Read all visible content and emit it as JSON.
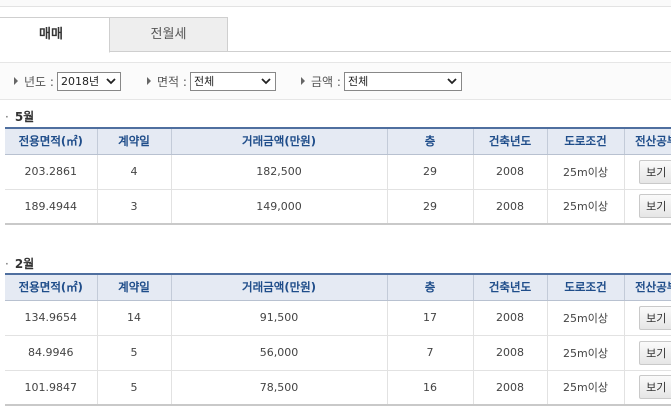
{
  "tabs": [
    {
      "label": "매매",
      "active": true
    },
    {
      "label": "전월세",
      "active": false
    }
  ],
  "filters": {
    "year": {
      "label": "년도 :",
      "value": "2018년"
    },
    "area": {
      "label": "면적 :",
      "value": "전체"
    },
    "price": {
      "label": "금액 :",
      "value": "전체"
    }
  },
  "columns": [
    "전용면적(㎡)",
    "계약일",
    "거래금액(만원)",
    "층",
    "건축년도",
    "도로조건",
    "전산공부"
  ],
  "sections": [
    {
      "month": "5월",
      "rows": [
        {
          "area": "203.2861",
          "day": "4",
          "price": "182,500",
          "floor": "29",
          "built": "2008",
          "road": "25m이상",
          "action": "보기"
        },
        {
          "area": "189.4944",
          "day": "3",
          "price": "149,000",
          "floor": "29",
          "built": "2008",
          "road": "25m이상",
          "action": "보기"
        }
      ]
    },
    {
      "month": "2월",
      "rows": [
        {
          "area": "134.9654",
          "day": "14",
          "price": "91,500",
          "floor": "17",
          "built": "2008",
          "road": "25m이상",
          "action": "보기"
        },
        {
          "area": "84.9946",
          "day": "5",
          "price": "56,000",
          "floor": "7",
          "built": "2008",
          "road": "25m이상",
          "action": "보기"
        },
        {
          "area": "101.9847",
          "day": "5",
          "price": "78,500",
          "floor": "16",
          "built": "2008",
          "road": "25m이상",
          "action": "보기"
        }
      ]
    }
  ],
  "colors": {
    "header_text": "#1f4d8a",
    "header_bg": "#e5eaf3",
    "header_rule": "#4f6f9f"
  }
}
